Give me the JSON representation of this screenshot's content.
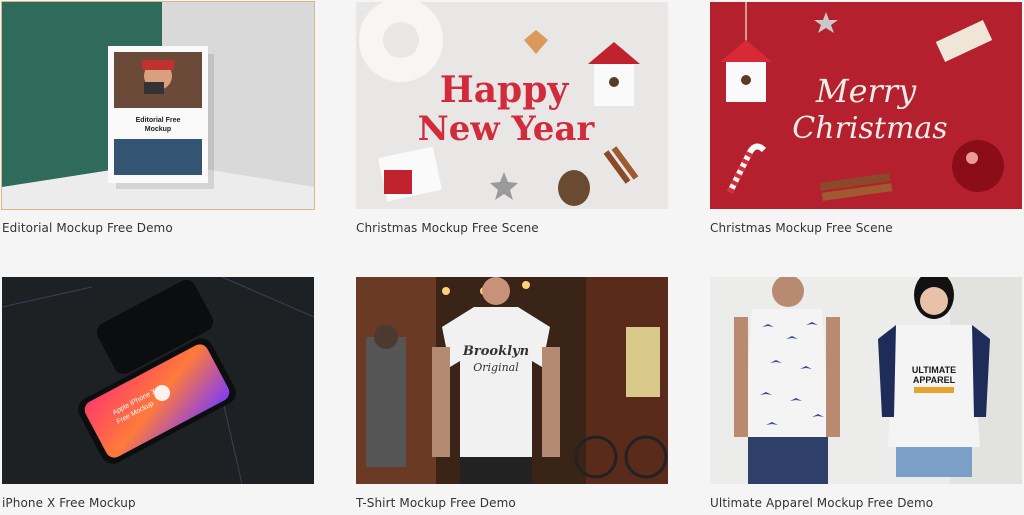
{
  "items": [
    {
      "title": "Editorial Mockup Free Demo",
      "thumb_text": {
        "heading": "Editorial Free",
        "sub": "Mockup"
      }
    },
    {
      "title": "Christmas Mockup Free Scene",
      "thumb_text": {
        "line1": "Happy",
        "line2": "New Year"
      }
    },
    {
      "title": "Christmas Mockup Free Scene",
      "thumb_text": {
        "line1": "Merry",
        "line2": "Christmas"
      }
    },
    {
      "title": "iPhone X Free Mockup",
      "thumb_text": {
        "line1": "Apple iPhone X",
        "line2": "Free Mockup"
      }
    },
    {
      "title": "T-Shirt Mockup Free Demo",
      "thumb_text": {
        "line1": "Brooklyn",
        "line2": "Original"
      }
    },
    {
      "title": "Ultimate Apparel Mockup Free Demo",
      "thumb_text": {
        "line1": "ULTIMATE",
        "line2": "APPAREL"
      }
    }
  ],
  "colors": {
    "background": "#f6f5f6",
    "caption": "#333333",
    "christmas_red": "#b5202e",
    "editorial_green": "#2f6a5a"
  }
}
